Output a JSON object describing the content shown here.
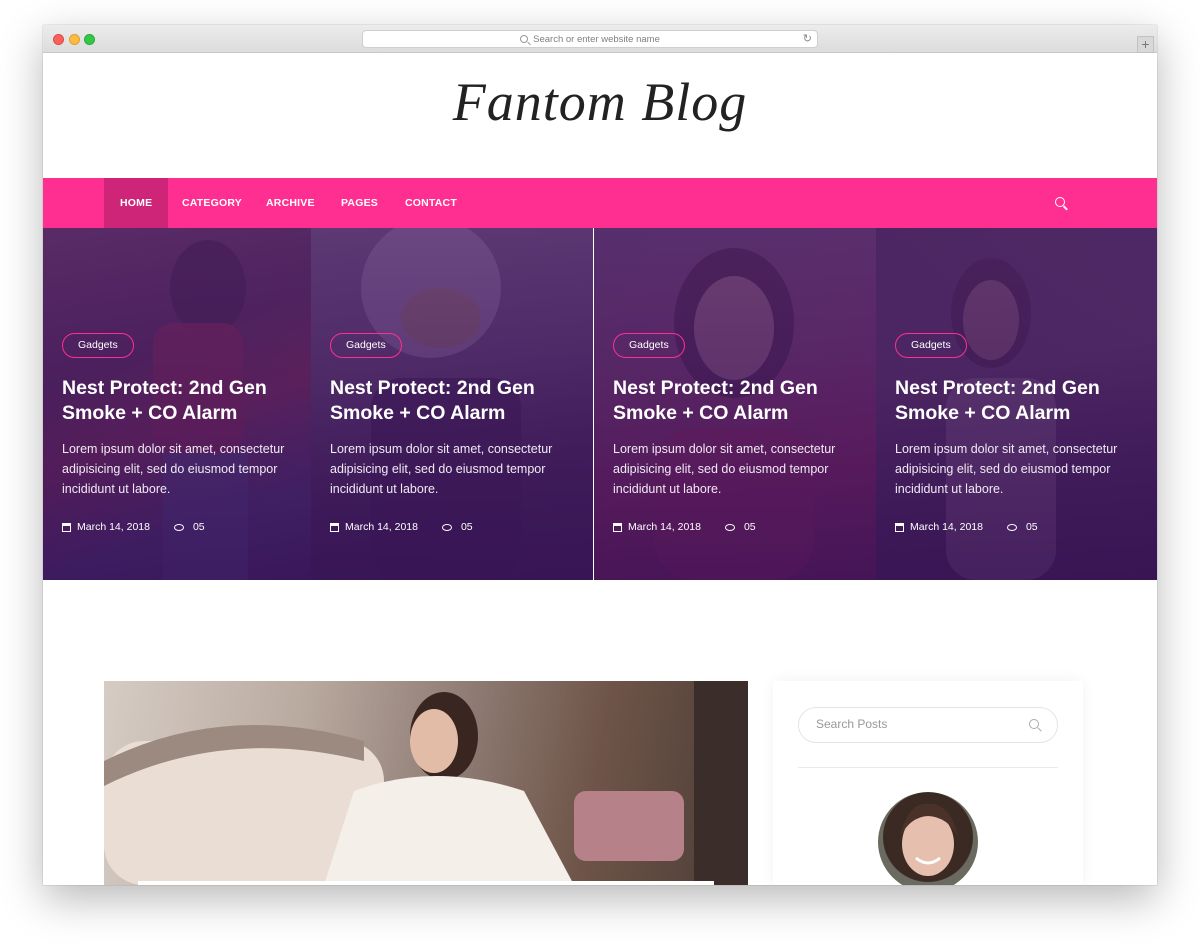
{
  "browser": {
    "url_placeholder": "Search or enter website name"
  },
  "site": {
    "logo_text": "Fantom Blog"
  },
  "nav": {
    "items": [
      {
        "label": "HOME",
        "active": true
      },
      {
        "label": "CATEGORY"
      },
      {
        "label": "ARCHIVE"
      },
      {
        "label": "PAGES"
      },
      {
        "label": "CONTACT"
      }
    ],
    "icon": "search-icon"
  },
  "featured": [
    {
      "category": "Gadgets",
      "title": "Nest Protect: 2nd Gen Smoke + CO Alarm",
      "excerpt": "Lorem ipsum dolor sit amet, consectetur adipisicing elit, sed do eiusmod tempor incididunt ut labore.",
      "date": "March 14, 2018",
      "comments": "05"
    },
    {
      "category": "Gadgets",
      "title": "Nest Protect: 2nd Gen Smoke + CO Alarm",
      "excerpt": "Lorem ipsum dolor sit amet, consectetur adipisicing elit, sed do eiusmod tempor incididunt ut labore.",
      "date": "March 14, 2018",
      "comments": "05"
    },
    {
      "category": "Gadgets",
      "title": "Nest Protect: 2nd Gen Smoke + CO Alarm",
      "excerpt": "Lorem ipsum dolor sit amet, consectetur adipisicing elit, sed do eiusmod tempor incididunt ut labore.",
      "date": "March 14, 2018",
      "comments": "05"
    },
    {
      "category": "Gadgets",
      "title": "Nest Protect: 2nd Gen Smoke + CO Alarm",
      "excerpt": "Lorem ipsum dolor sit amet, consectetur adipisicing elit, sed do eiusmod tempor incididunt ut labore.",
      "date": "March 14, 2018",
      "comments": "05"
    }
  ],
  "sidebar": {
    "search_placeholder": "Search Posts"
  },
  "colors": {
    "accent": "#ff2f92",
    "nav_active": "#cf2579",
    "overlay": "#502369"
  }
}
